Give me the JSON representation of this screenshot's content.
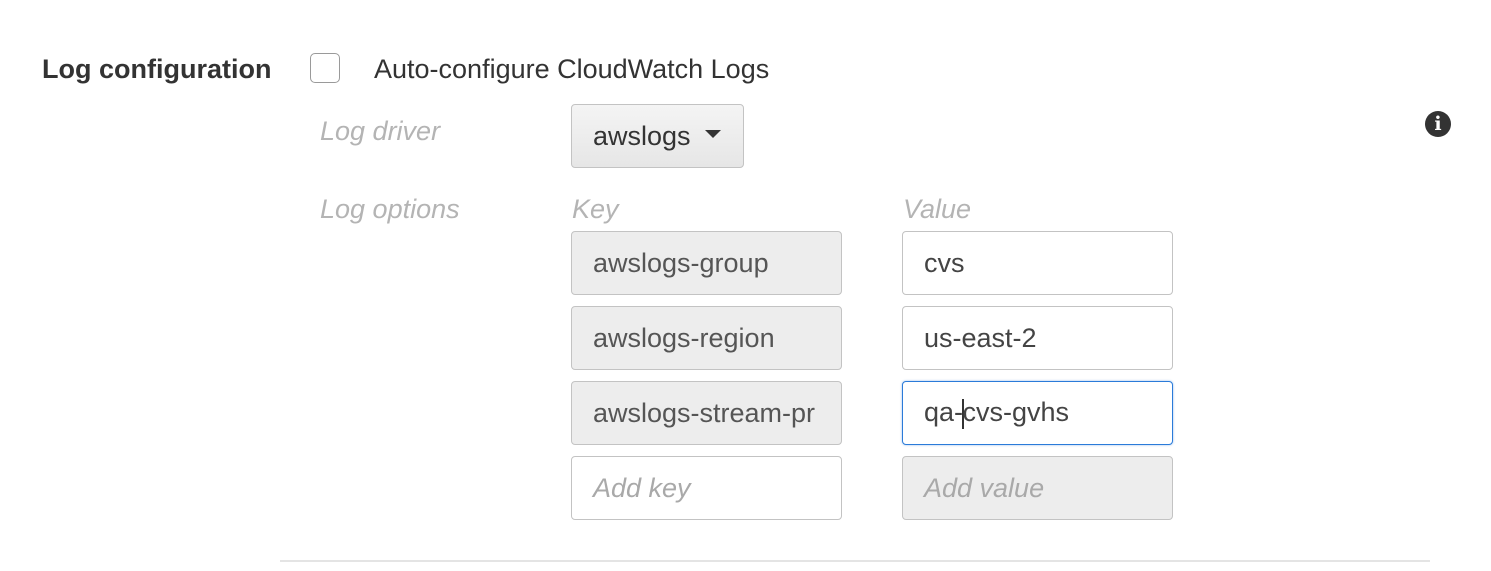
{
  "section": {
    "title": "Log configuration"
  },
  "auto_configure": {
    "label": "Auto-configure CloudWatch Logs",
    "checked": false
  },
  "log_driver": {
    "label": "Log driver",
    "selected": "awslogs"
  },
  "log_options": {
    "label": "Log options",
    "key_header": "Key",
    "value_header": "Value",
    "rows": [
      {
        "key": "awslogs-group",
        "value": "cvs"
      },
      {
        "key": "awslogs-region",
        "value": "us-east-2"
      },
      {
        "key": "awslogs-stream-pr",
        "value_before_cursor": "qa-",
        "value_after_cursor": "cvs-gvhs"
      }
    ],
    "new_row": {
      "key_placeholder": "Add key",
      "value_placeholder": "Add value"
    }
  },
  "icons": {
    "info": "info-icon",
    "dropdown": "caret-down-icon"
  },
  "colors": {
    "focus_border": "#2b7bd9",
    "label_muted": "#b4b4b4",
    "text": "#333333"
  }
}
